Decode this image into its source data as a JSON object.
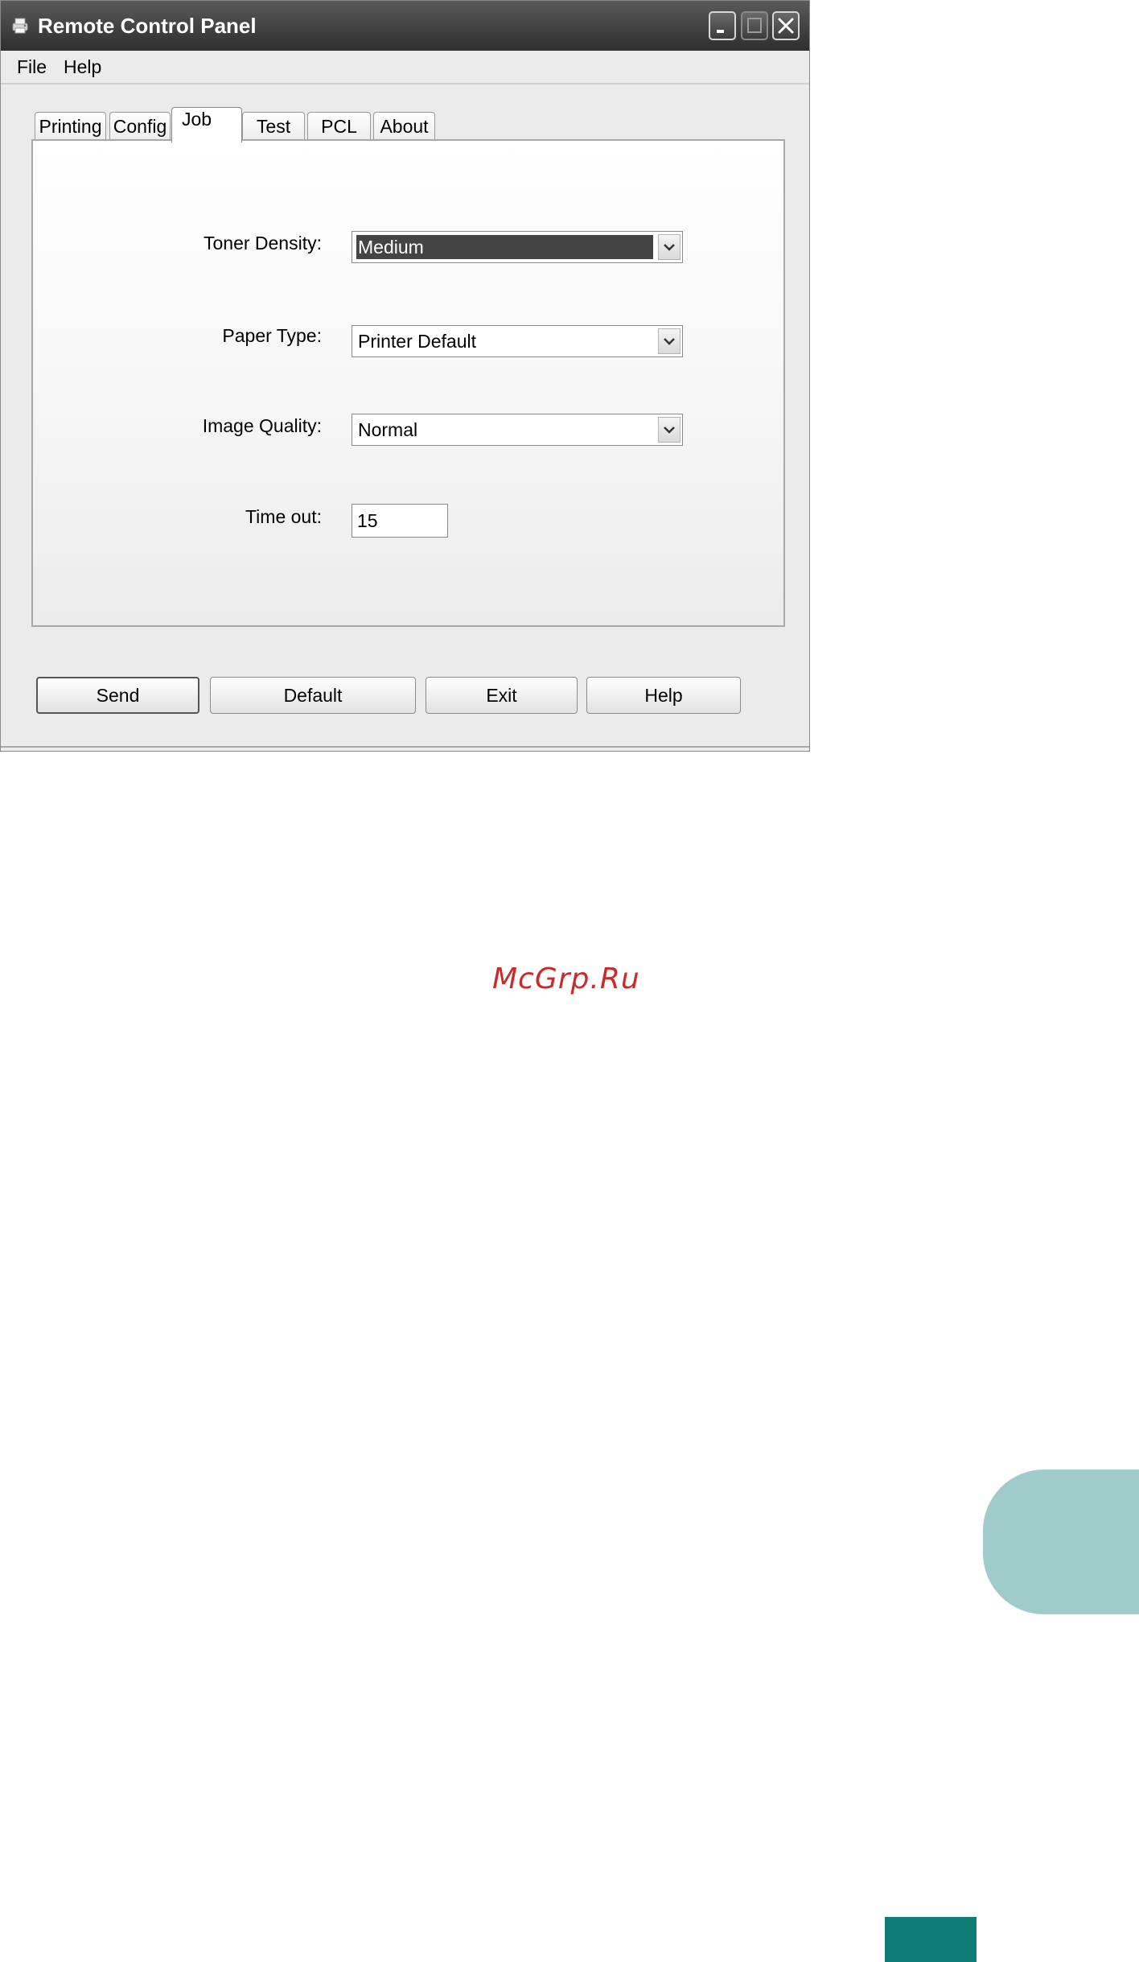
{
  "window": {
    "title": "Remote Control Panel",
    "icons": {
      "app": "printer-icon",
      "minimize": "minimize-icon",
      "maximize": "maximize-icon",
      "close": "close-icon"
    }
  },
  "menu": {
    "file": "File",
    "help": "Help"
  },
  "tabs": [
    {
      "label": "Printing",
      "active": false
    },
    {
      "label": "Config",
      "active": false
    },
    {
      "label": "Job",
      "active": true
    },
    {
      "label": "Test",
      "active": false
    },
    {
      "label": "PCL",
      "active": false
    },
    {
      "label": "About",
      "active": false
    }
  ],
  "job": {
    "toner_density": {
      "label": "Toner Density:",
      "value": "Medium"
    },
    "paper_type": {
      "label": "Paper Type:",
      "value": "Printer Default"
    },
    "image_quality": {
      "label": "Image Quality:",
      "value": "Normal"
    },
    "timeout": {
      "label": "Time out:",
      "value": "15"
    }
  },
  "buttons": {
    "send": "Send",
    "default": "Default",
    "exit": "Exit",
    "help": "Help"
  },
  "watermark": "McGrp.Ru",
  "colors": {
    "titlebar": "#3a3a3a",
    "window_bg": "#ebebeb",
    "selection": "#444444",
    "watermark": "#cc2a2a",
    "side_tab": "#9fcbca",
    "corner_block": "#0f7c77"
  }
}
